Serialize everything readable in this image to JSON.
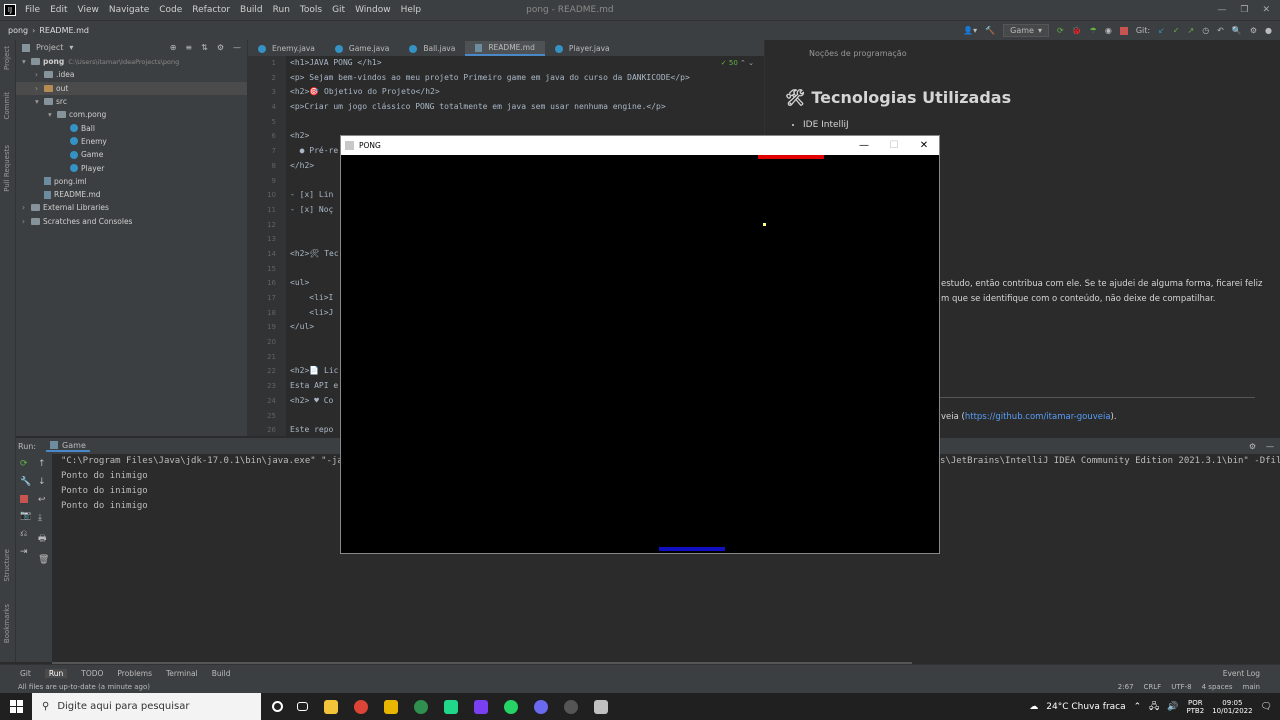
{
  "menubar": {
    "items": [
      "File",
      "Edit",
      "View",
      "Navigate",
      "Code",
      "Refactor",
      "Build",
      "Run",
      "Tools",
      "Git",
      "Window",
      "Help"
    ],
    "title": "pong - README.md",
    "run_config": "Game",
    "git_label": "Git:"
  },
  "navbar": {
    "project_name": "pong",
    "file": "README.md"
  },
  "project_panel": {
    "title": "Project",
    "tree": [
      {
        "label": "pong",
        "path": "C:\\Users\\itamar\\IdeaProjects\\pong",
        "depth": 0,
        "kind": "folder"
      },
      {
        "label": ".idea",
        "depth": 1,
        "kind": "folder"
      },
      {
        "label": "out",
        "depth": 1,
        "kind": "folder-orange"
      },
      {
        "label": "src",
        "depth": 1,
        "kind": "folder"
      },
      {
        "label": "com.pong",
        "depth": 2,
        "kind": "folder"
      },
      {
        "label": "Ball",
        "depth": 3,
        "kind": "class"
      },
      {
        "label": "Enemy",
        "depth": 3,
        "kind": "class"
      },
      {
        "label": "Game",
        "depth": 3,
        "kind": "class"
      },
      {
        "label": "Player",
        "depth": 3,
        "kind": "class"
      },
      {
        "label": "pong.iml",
        "depth": 1,
        "kind": "file"
      },
      {
        "label": "README.md",
        "depth": 1,
        "kind": "file"
      },
      {
        "label": "External Libraries",
        "depth": 0,
        "kind": "folder"
      },
      {
        "label": "Scratches and Consoles",
        "depth": 0,
        "kind": "folder"
      }
    ]
  },
  "left_strip": {
    "labels": [
      "Project",
      "Commit",
      "Pull Requests"
    ]
  },
  "editor": {
    "tabs": [
      {
        "label": "Enemy.java"
      },
      {
        "label": "Game.java"
      },
      {
        "label": "Ball.java"
      },
      {
        "label": "README.md",
        "active": true
      },
      {
        "label": "Player.java"
      }
    ],
    "inspection_count": "50",
    "line_numbers": [
      "1",
      "2",
      "3",
      "4",
      "5",
      "6",
      "7",
      "8",
      "9",
      "10",
      "11",
      "12",
      "13",
      "14",
      "15",
      "16",
      "17",
      "18",
      "19",
      "20",
      "21",
      "22",
      "23",
      "24",
      "25",
      "26"
    ],
    "lines": [
      "<h1>JAVA PONG </h1>",
      "<p> Sejam bem-vindos ao meu projeto Primeiro game em java do curso da DANKICODE</p>",
      "<h2>🎯 Objetivo do Projeto</h2>",
      "<p>Criar um jogo clássico PONG totalmente em java sem usar nenhuma engine.</p>",
      "",
      "<h2>",
      "  ● Pré-re",
      "</h2>",
      "",
      "- [x] Lin",
      "- [x] Noç",
      "",
      "",
      "<h2>🛠 Tec",
      "",
      "<ul>",
      "    <li>I",
      "    <li>J",
      "</ul>",
      "",
      "",
      "<h2>📄 Lic",
      "Esta API e",
      "<h2> ♥ Co",
      "",
      "Este repo"
    ]
  },
  "preview": {
    "top_partial": "Noções de programação",
    "heading": "Tecnologias Utilizadas",
    "list": [
      "IDE IntelliJ"
    ],
    "para1": "estudo, então contribua com ele. Se te ajudei de alguma forma, ficarei feliz",
    "para2": "m que se identifique com o conteúdo, não deixe de compatilhar.",
    "link_prefix": "veia (",
    "link": "https://github.com/itamar-gouveia",
    "link_suffix": ")."
  },
  "run_panel": {
    "label": "Run:",
    "config": "Game",
    "console": [
      "\"C:\\Program Files\\Java\\jdk-17.0.1\\bin\\java.exe\" \"-ja",
      "Ponto do inimigo",
      "Ponto do inimigo",
      "Ponto do inimigo"
    ],
    "console_right": "s\\JetBrains\\IntelliJ IDEA Community Edition 2021.3.1\\bin\" -Dfile"
  },
  "pong_window": {
    "title": "PONG",
    "enemy_color": "#e00000",
    "player_color": "#1010c0",
    "ball_color": "#ffff80"
  },
  "bottom_tabs": [
    "Git",
    "Run",
    "TODO",
    "Problems",
    "Terminal",
    "Build"
  ],
  "bottom_right": "Event Log",
  "status": {
    "message": "All files are up-to-date (a minute ago)",
    "position": "2:67",
    "line_sep": "CRLF",
    "encoding": "UTF-8",
    "indent": "4 spaces",
    "branch": "main"
  },
  "taskbar": {
    "search_placeholder": "Digite aqui para pesquisar",
    "weather": "24°C  Chuva fraca",
    "lang1": "POR",
    "lang2": "PTB2",
    "time": "09:05",
    "date": "10/01/2022"
  }
}
